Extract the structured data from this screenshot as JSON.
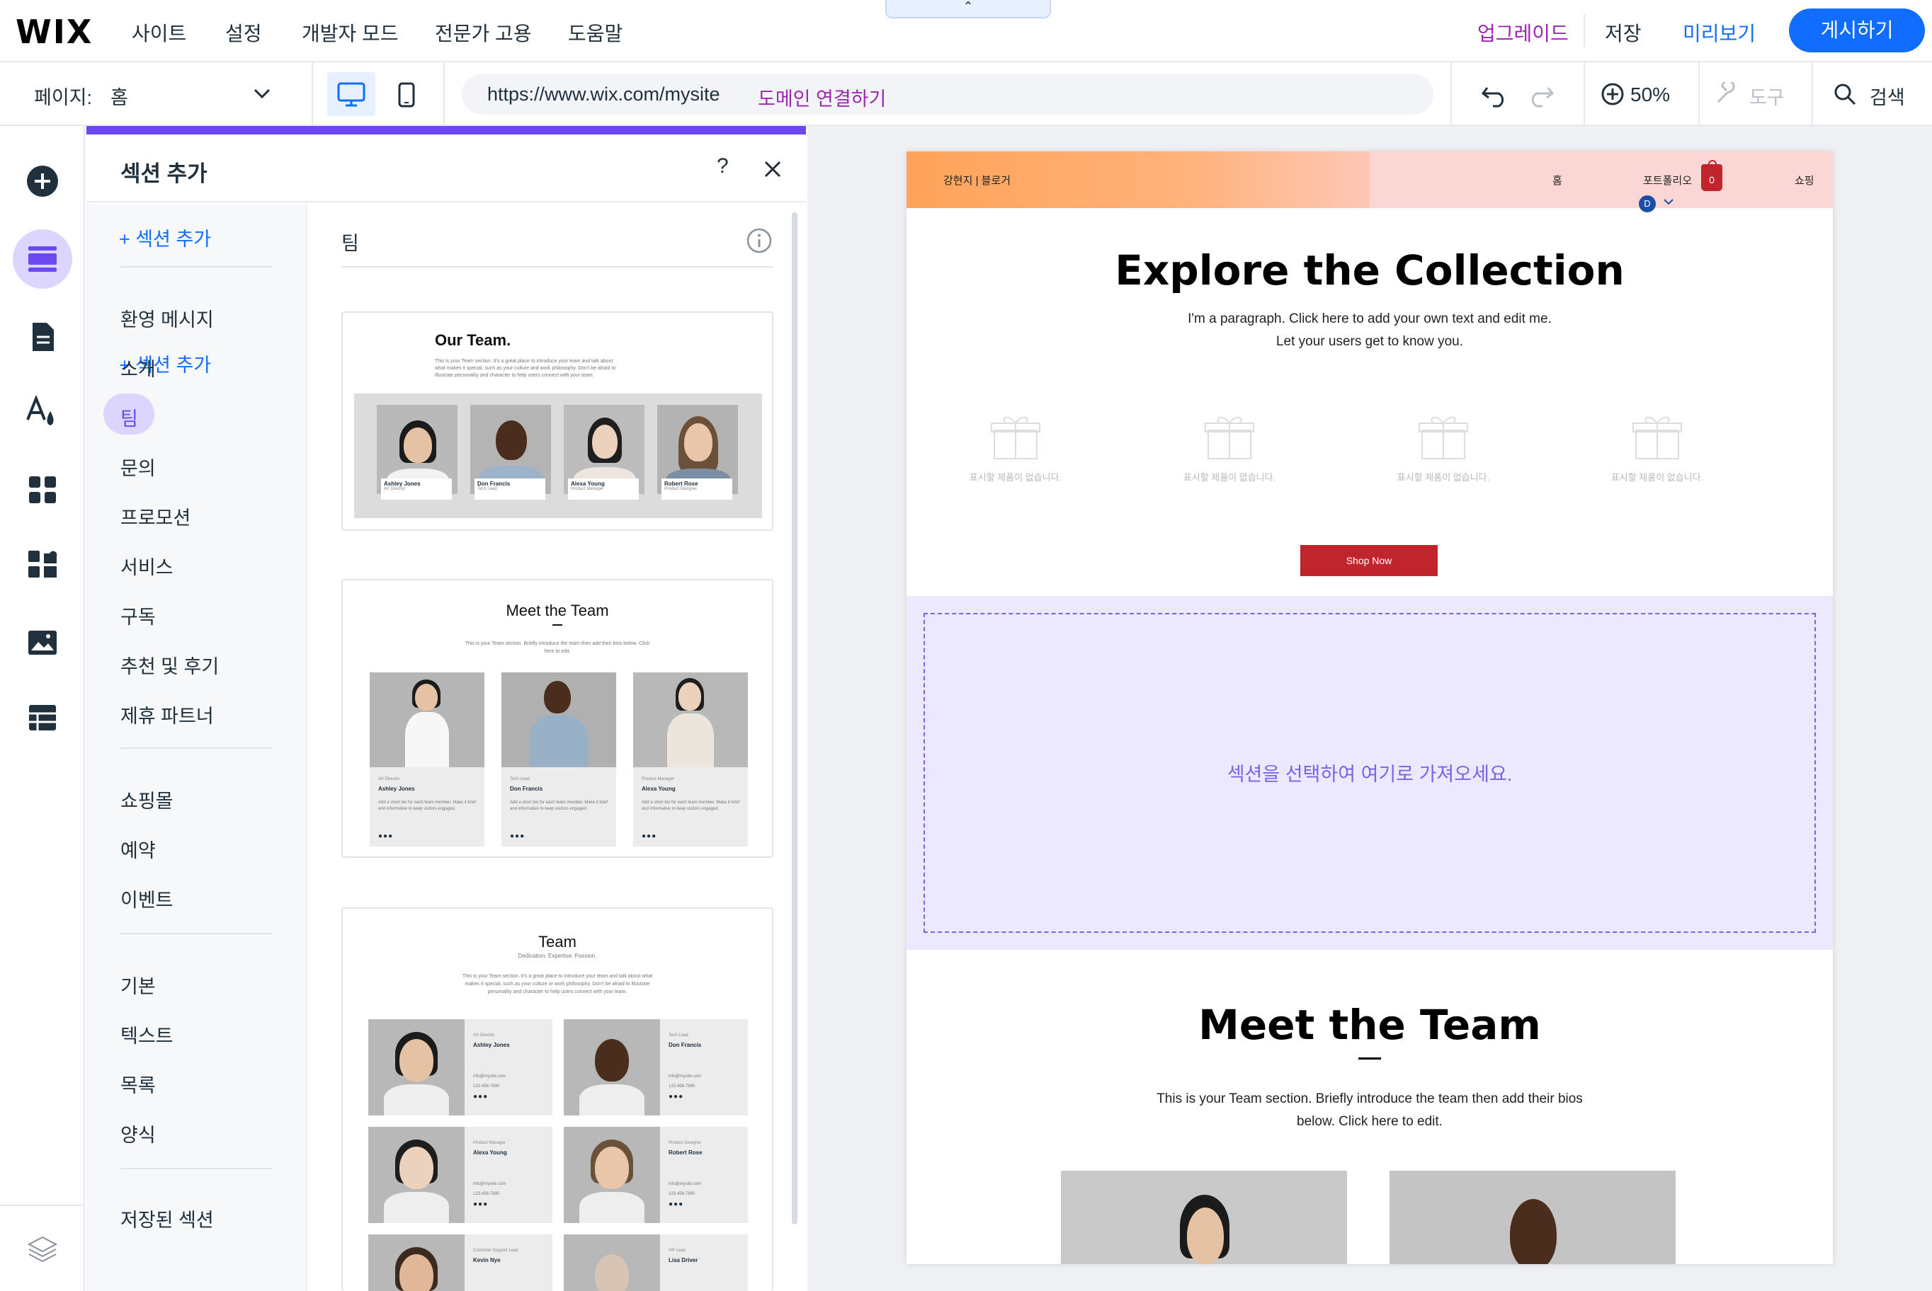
{
  "topbar": {
    "logo": "WIX",
    "menu": [
      "사이트",
      "설정",
      "개발자 모드",
      "전문가 고용",
      "도움말"
    ],
    "upgrade": "업그레이드",
    "save": "저장",
    "preview": "미리보기",
    "publish": "게시하기",
    "collapse_icon": "chevron-up"
  },
  "toolbar": {
    "page_label": "페이지:",
    "page_value": "홈",
    "url": "https://www.wix.com/mysite",
    "connect_domain": "도메인 연결하기",
    "zoom": "50%",
    "tools": "도구",
    "search": "검색"
  },
  "panel": {
    "title": "섹션 추가",
    "add_section": "+ 섹션 추가",
    "current_category": "팀",
    "categories_group1": [
      "환영 메시지",
      "소개",
      "팀",
      "문의",
      "프로모션",
      "서비스",
      "구독",
      "추천 및 후기",
      "제휴 파트너"
    ],
    "categories_group2": [
      "쇼핑몰",
      "예약",
      "이벤트"
    ],
    "categories_group3": [
      "기본",
      "텍스트",
      "목록",
      "양식"
    ],
    "saved_sections": "저장된 섹션",
    "selected_category": "팀"
  },
  "cards": {
    "card1": {
      "title": "Our Team.",
      "body": "This is your Team section. It's a great place to introduce your team and talk about what makes it special, such as your culture and work philosophy. Don't be afraid to illustrate personality and character to help users connect with your team.",
      "members": [
        {
          "name": "Ashley Jones",
          "role": "Art Director"
        },
        {
          "name": "Don Francis",
          "role": "Tech Lead"
        },
        {
          "name": "Alexa Young",
          "role": "Product Manager"
        },
        {
          "name": "Robert Rose",
          "role": "Product Designer"
        }
      ]
    },
    "card2": {
      "title": "Meet the Team",
      "body": "This is your Team section. Briefly introduce the team then add their bios below. Click here to edit.",
      "members": [
        {
          "role": "Art Director",
          "name": "Ashley Jones",
          "bio": "Add a short bio for each team member. Make it brief and informative to keep visitors engaged."
        },
        {
          "role": "Tech Lead",
          "name": "Don Francis",
          "bio": "Add a short bio for each team member. Make it brief and informative to keep visitors engaged."
        },
        {
          "role": "Product Manager",
          "name": "Alexa Young",
          "bio": "Add a short bio for each team member. Make it brief and informative to keep visitors engaged."
        }
      ]
    },
    "card3": {
      "title": "Team",
      "subtitle": "Dedication. Expertise. Passion.",
      "body": "This is your Team section. It's a great place to introduce your team and talk about what makes it special, such as your culture or work philosophy. Don't be afraid to illustrate personality and character to help users connect with your team.",
      "members": [
        {
          "role": "Art Director",
          "name": "Ashley Jones",
          "email": "info@mysite.com",
          "phone": "123-456-7890"
        },
        {
          "role": "Tech Lead",
          "name": "Don Francis",
          "email": "info@mysite.com",
          "phone": "123-456-7890"
        },
        {
          "role": "Product Manager",
          "name": "Alexa Young",
          "email": "info@mysite.com",
          "phone": "123-456-7890"
        },
        {
          "role": "Product Designer",
          "name": "Robert Rose",
          "email": "info@mysite.com",
          "phone": "123-456-7890"
        },
        {
          "role": "Customer Support Lead",
          "name": "Kevin Nye"
        },
        {
          "role": "HR Lead",
          "name": "Lisa Driver"
        }
      ]
    }
  },
  "site": {
    "brand": "강현지 | 블로거",
    "nav": [
      "홈",
      "포트폴리오",
      "쇼핑"
    ],
    "cart_count": "0",
    "avatar_letter": "D",
    "hero_title": "Explore the Collection",
    "hero_para_line1": "I'm a paragraph. Click here to add your own text and edit me.",
    "hero_para_line2": "Let your users get to know you.",
    "empty_product": "표시할 제품이 없습니다.",
    "shop_button": "Shop Now",
    "drop_text": "섹션을 선택하여 여기로 가져오세요.",
    "team_title": "Meet the Team",
    "team_para_line1": "This is your Team section. Briefly introduce the team then add their bios",
    "team_para_line2": "below. Click here to edit."
  },
  "colors": {
    "accent": "#116dff",
    "purple": "#6c48ef",
    "upgrade": "#9c27b0",
    "shop_button": "#c0252d",
    "drop_zone": "#ece9ff"
  }
}
